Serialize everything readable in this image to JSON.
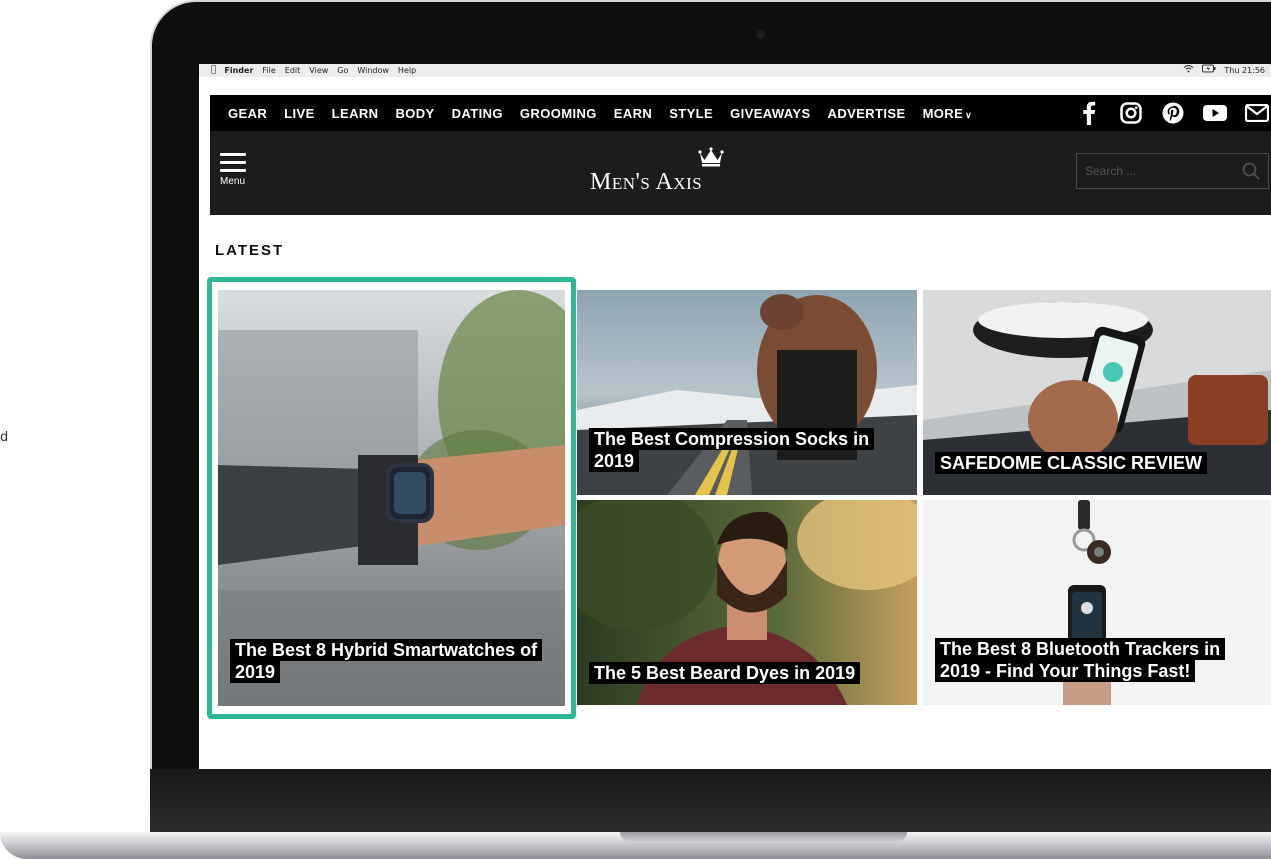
{
  "stray_glyph": "d",
  "mac_menubar": {
    "app_name": "Finder",
    "menus": [
      "File",
      "Edit",
      "View",
      "Go",
      "Window",
      "Help"
    ],
    "clock": "Thu 21:56"
  },
  "nav": {
    "items": [
      "GEAR",
      "LIVE",
      "LEARN",
      "BODY",
      "DATING",
      "GROOMING",
      "EARN",
      "STYLE",
      "GIVEAWAYS",
      "ADVERTISE",
      "MORE"
    ],
    "social_icons": [
      "facebook-icon",
      "instagram-icon",
      "pinterest-icon",
      "youtube-icon",
      "mail-icon"
    ]
  },
  "header": {
    "menu_label": "Menu",
    "logo_text": "Men's Axis",
    "search_placeholder": "Search ..."
  },
  "section": {
    "title": "LATEST"
  },
  "articles": [
    {
      "title": "The Best 8 Hybrid Smartwatches of 2019",
      "image": "wrist-watch-photo"
    },
    {
      "title": "The Best Compression Socks in 2019",
      "image": "athlete-on-road-photo"
    },
    {
      "title": "SAFEDOME CLASSIC REVIEW",
      "image": "phone-and-wallet-photo"
    },
    {
      "title": "The 5 Best Beard Dyes in 2019",
      "image": "bearded-man-photo"
    },
    {
      "title": "The Best 8 Bluetooth Trackers in 2019 - Find Your Things Fast!",
      "image": "keys-and-tracker-photo"
    }
  ],
  "colors": {
    "highlight": "#2fb897",
    "nav_bg": "#000000",
    "header_bg": "#1c1c1c"
  }
}
